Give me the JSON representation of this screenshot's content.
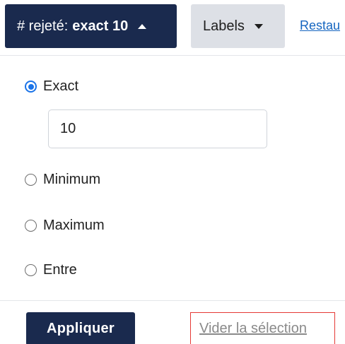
{
  "filter": {
    "prefix": "# rejeté:",
    "value": "exact 10"
  },
  "labels_button": "Labels",
  "restore_link": "Restau",
  "options": {
    "exact": "Exact",
    "minimum": "Minimum",
    "maximum": "Maximum",
    "entre": "Entre"
  },
  "selected_option": "Exact",
  "exact_input": {
    "value": "10"
  },
  "actions": {
    "apply": "Appliquer",
    "clear": "Vider la sélection"
  },
  "colors": {
    "primary_navy": "#1a2a4e",
    "labels_bg": "#dde0e6",
    "link_blue": "#1565c0",
    "radio_blue": "#1a73e8",
    "highlight_red": "#e53935"
  }
}
